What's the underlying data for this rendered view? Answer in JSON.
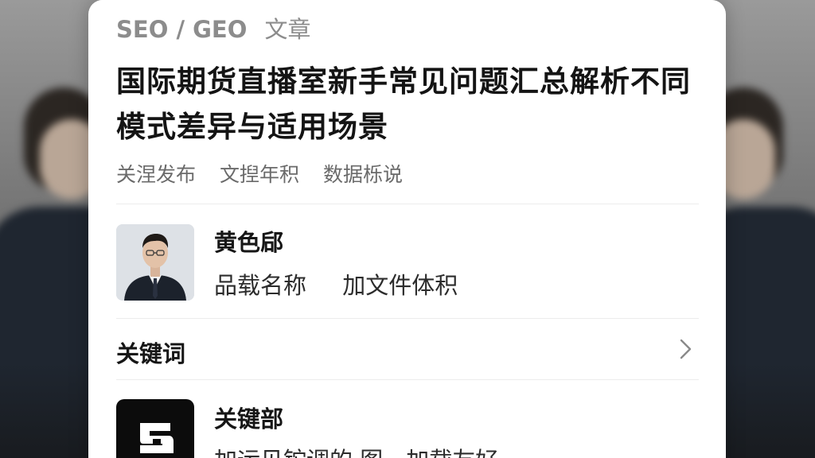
{
  "article": {
    "category_primary": "SEO / GEO",
    "category_secondary": "文章",
    "title": "国际期货直播室新手常见问题汇总解析不同模式差异与适用场景",
    "meta": [
      "关涅发布",
      "文揑年积",
      "数据栎说"
    ]
  },
  "author": {
    "name": "黄色郈",
    "meta": [
      "品载名称",
      "加文件体积"
    ],
    "avatar_icon": "person-portrait"
  },
  "keywords": {
    "label": "关键词",
    "icon": "chevron-right-icon"
  },
  "app": {
    "name": "关键部",
    "desc": "加运见铊调的 图，加载友好",
    "logo_icon": "app-logo-icon",
    "logo_color": "#0c0c0c"
  },
  "colors": {
    "title": "#141414",
    "muted": "#8c8c8c",
    "background_card": "#ffffff"
  }
}
